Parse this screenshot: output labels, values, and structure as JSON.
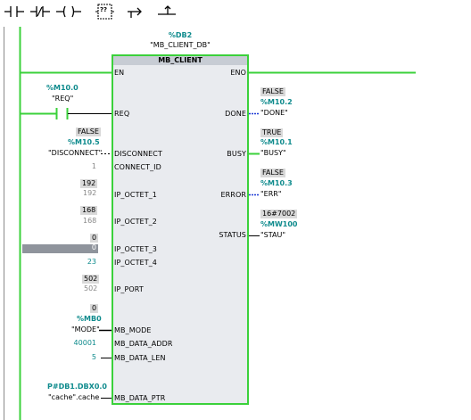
{
  "toolbar": {
    "items": [
      {
        "name": "no-contact-icon"
      },
      {
        "name": "nc-contact-icon"
      },
      {
        "name": "output-coil-icon"
      },
      {
        "name": "empty-box-icon",
        "text": "??"
      },
      {
        "name": "open-branch-icon"
      },
      {
        "name": "close-branch-icon"
      }
    ]
  },
  "block": {
    "db_address": "%DB2",
    "db_name": "\"MB_CLIENT_DB\"",
    "title": "MB_CLIENT",
    "inputs": {
      "en": "EN",
      "req": "REQ",
      "disconnect": "DISCONNECT",
      "connect_id": "CONNECT_ID",
      "ip_octet_1": "IP_OCTET_1",
      "ip_octet_2": "IP_OCTET_2",
      "ip_octet_3": "IP_OCTET_3",
      "ip_octet_4": "IP_OCTET_4",
      "ip_port": "IP_PORT",
      "mb_mode": "MB_MODE",
      "mb_data_addr": "MB_DATA_ADDR",
      "mb_data_len": "MB_DATA_LEN",
      "mb_data_ptr": "MB_DATA_PTR"
    },
    "outputs": {
      "eno": "ENO",
      "done": "DONE",
      "busy": "BUSY",
      "error": "ERROR",
      "status": "STATUS"
    }
  },
  "operands_in": {
    "req_addr": "%M10.0",
    "req_tag": "\"REQ\"",
    "disc_monitor": "FALSE",
    "disc_addr": "%M10.5",
    "disc_tag": "\"DISCONNECT\"",
    "connect_id_value": "1",
    "oct1_monitor": "192",
    "oct1_value": "192",
    "oct2_monitor": "168",
    "oct2_value": "168",
    "oct3_monitor": "0",
    "oct3_value": "0",
    "oct4_value": "23",
    "port_monitor": "502",
    "port_value": "502",
    "mode_monitor": "0",
    "mode_addr": "%MB0",
    "mode_tag": "\"MODE\"",
    "data_addr_value": "40001",
    "data_len_value": "5",
    "ptr_addr": "P#DB1.DBX0.0",
    "ptr_tag": "\"cache\".cache"
  },
  "operands_out": {
    "done_monitor": "FALSE",
    "done_addr": "%M10.2",
    "done_tag": "\"DONE\"",
    "busy_monitor": "TRUE",
    "busy_addr": "%M10.1",
    "busy_tag": "\"BUSY\"",
    "error_monitor": "FALSE",
    "error_addr": "%M10.3",
    "error_tag": "\"ERR\"",
    "status_monitor": "16#7002",
    "status_addr": "%MW100",
    "status_tag": "\"STAU\""
  },
  "colors": {
    "power_flow": "#3bd13b",
    "teal_address": "#0f8b8d",
    "block_fill": "#e9ebef",
    "monitor_bg": "#d9d9d9"
  }
}
